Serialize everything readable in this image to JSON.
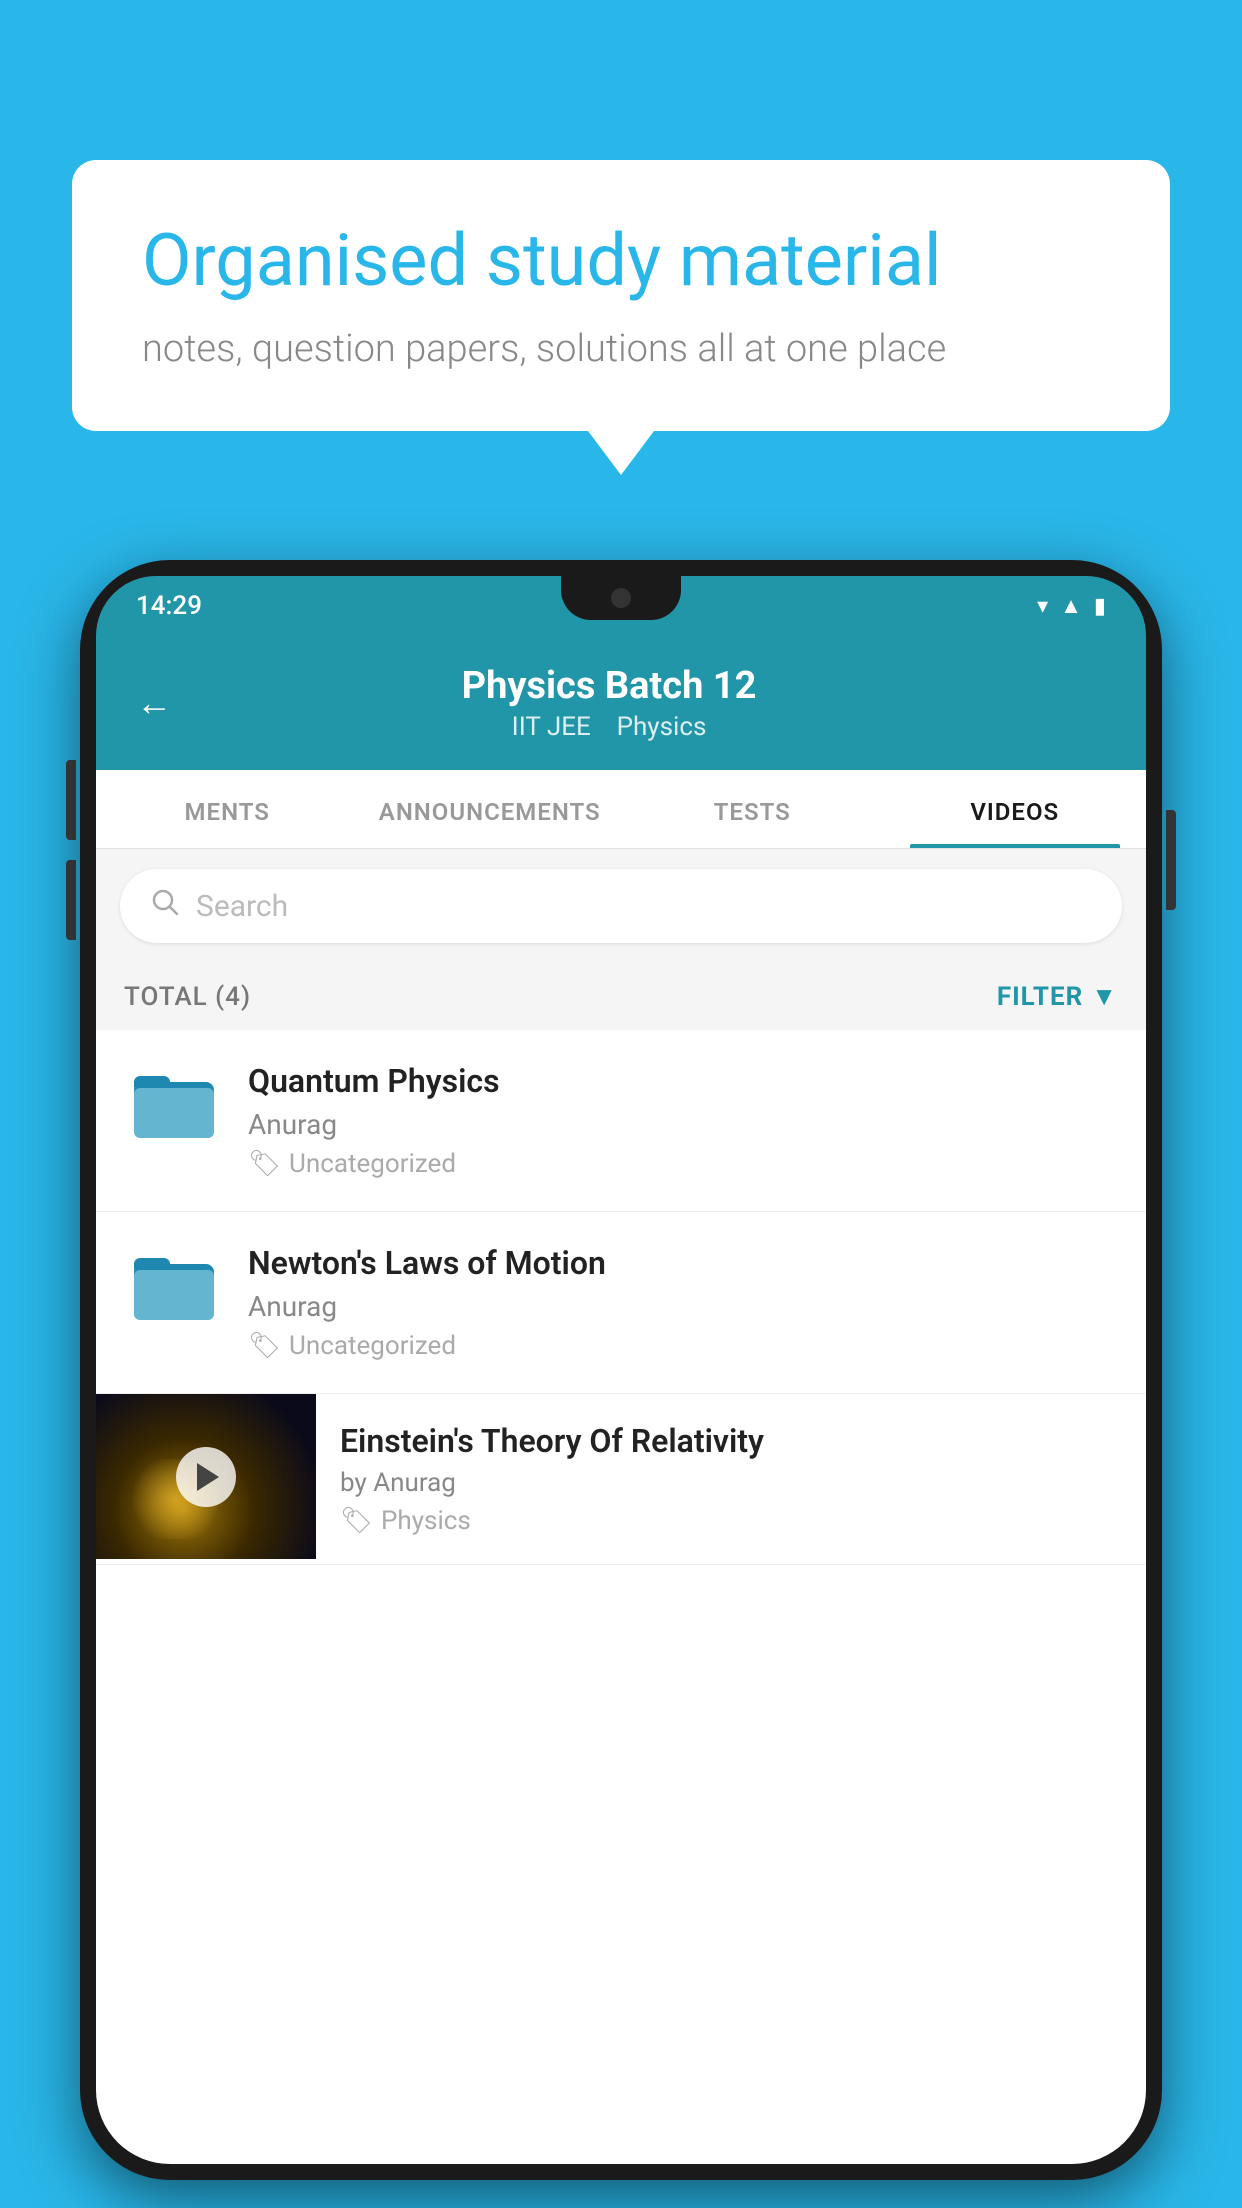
{
  "background_color": "#29b6e8",
  "speech_bubble": {
    "title": "Organised study material",
    "subtitle": "notes, question papers, solutions all at one place"
  },
  "phone": {
    "status_bar": {
      "time": "14:29"
    },
    "header": {
      "title": "Physics Batch 12",
      "subtitle_1": "IIT JEE",
      "subtitle_2": "Physics",
      "back_label": "←"
    },
    "tabs": [
      {
        "label": "MENTS",
        "active": false
      },
      {
        "label": "ANNOUNCEMENTS",
        "active": false
      },
      {
        "label": "TESTS",
        "active": false
      },
      {
        "label": "VIDEOS",
        "active": true
      }
    ],
    "search": {
      "placeholder": "Search"
    },
    "filter_bar": {
      "total_label": "TOTAL (4)",
      "filter_label": "FILTER"
    },
    "videos": [
      {
        "id": 1,
        "title": "Quantum Physics",
        "author": "Anurag",
        "tag": "Uncategorized",
        "has_thumb": false
      },
      {
        "id": 2,
        "title": "Newton's Laws of Motion",
        "author": "Anurag",
        "tag": "Uncategorized",
        "has_thumb": false
      },
      {
        "id": 3,
        "title": "Einstein's Theory Of Relativity",
        "author": "by Anurag",
        "tag": "Physics",
        "has_thumb": true
      }
    ]
  }
}
